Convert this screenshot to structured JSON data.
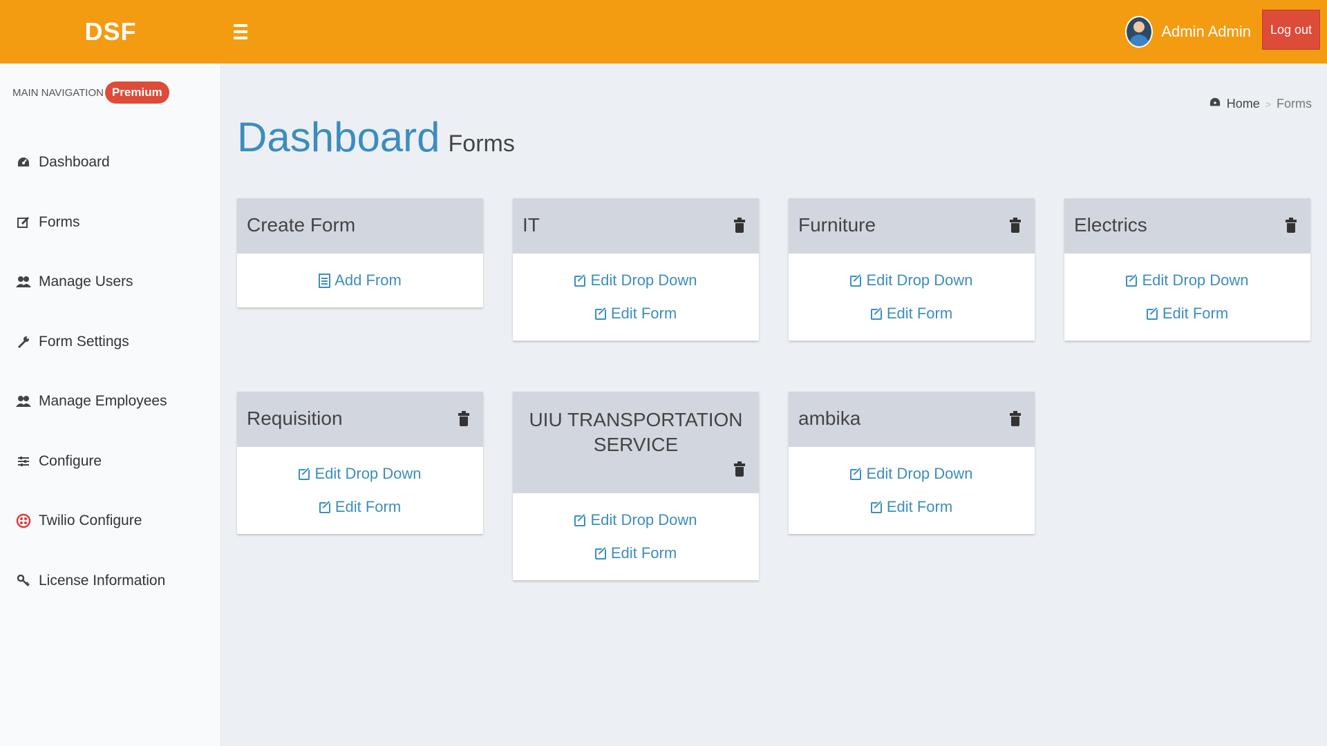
{
  "header": {
    "logo": "DSF",
    "user_name": "Admin Admin",
    "logout_label": "Log out",
    "accent_color": "#f39c12"
  },
  "sidebar": {
    "nav_header": "MAIN NAVIGATION",
    "badge": "Premium",
    "items": [
      {
        "label": "Dashboard",
        "icon": "dashboard-icon"
      },
      {
        "label": "Forms",
        "icon": "edit-icon"
      },
      {
        "label": "Manage Users",
        "icon": "users-icon"
      },
      {
        "label": "Form Settings",
        "icon": "wrench-icon"
      },
      {
        "label": "Manage Employees",
        "icon": "users-icon"
      },
      {
        "label": "Configure",
        "icon": "sliders-icon"
      },
      {
        "label": "Twilio Configure",
        "icon": "twilio-icon"
      },
      {
        "label": "License Information",
        "icon": "key-icon"
      }
    ]
  },
  "breadcrumb": {
    "home": "Home",
    "current": "Forms"
  },
  "page": {
    "title": "Dashboard",
    "subtitle": "Forms"
  },
  "cards": [
    {
      "title": "Create Form",
      "links": [
        "Add From"
      ]
    },
    {
      "title": "IT",
      "links": [
        "Edit Drop Down",
        "Edit Form"
      ]
    },
    {
      "title": "Furniture",
      "links": [
        "Edit Drop Down",
        "Edit Form"
      ]
    },
    {
      "title": "Electrics",
      "links": [
        "Edit Drop Down",
        "Edit Form"
      ]
    },
    {
      "title": "Requisition",
      "links": [
        "Edit Drop Down",
        "Edit Form"
      ]
    },
    {
      "title": "UIU TRANSPORTATION SERVICE",
      "links": [
        "Edit Drop Down",
        "Edit Form"
      ]
    },
    {
      "title": "ambika",
      "links": [
        "Edit Drop Down",
        "Edit Form"
      ]
    }
  ]
}
